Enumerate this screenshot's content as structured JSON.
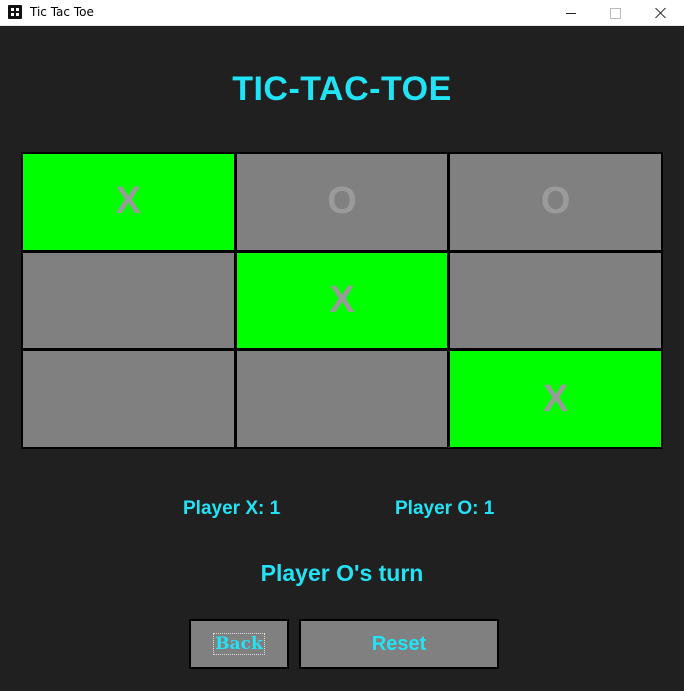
{
  "window": {
    "title": "Tic Tac Toe",
    "icon": "app-dice-icon",
    "controls": [
      "minimize-icon",
      "maximize-icon",
      "close-icon"
    ]
  },
  "game": {
    "heading": "TIC-TAC-TOE",
    "board": [
      {
        "mark": "X",
        "winning": true
      },
      {
        "mark": "O",
        "winning": false
      },
      {
        "mark": "O",
        "winning": false
      },
      {
        "mark": "",
        "winning": false
      },
      {
        "mark": "X",
        "winning": true
      },
      {
        "mark": "",
        "winning": false
      },
      {
        "mark": "",
        "winning": false
      },
      {
        "mark": "",
        "winning": false
      },
      {
        "mark": "X",
        "winning": true
      }
    ],
    "score_x": "Player X: 1",
    "score_o": "Player O: 1",
    "turn": "Player O's turn",
    "back_label": "Back",
    "reset_label": "Reset"
  },
  "colors": {
    "background": "#202020",
    "accent": "#22e3f5",
    "cell": "#808080",
    "winning_cell": "#00ff00",
    "mark": "#9a9a9a"
  }
}
